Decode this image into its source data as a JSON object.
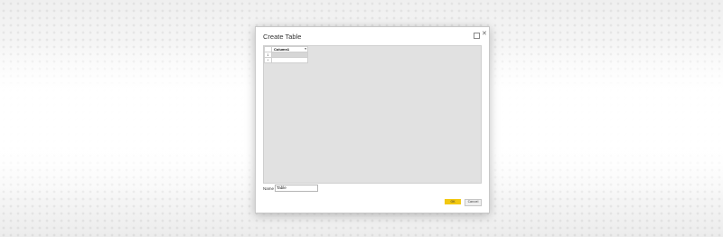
{
  "dialog": {
    "title": "Create Table",
    "restore_icon": "restore-icon",
    "close_glyph": "✕"
  },
  "table": {
    "column_header": "Column1",
    "dropdown_glyph": "▾",
    "rows": [
      {
        "marker": "1",
        "value": ""
      },
      {
        "marker": "*",
        "value": ""
      }
    ]
  },
  "name_field": {
    "label": "Name",
    "value": "Table"
  },
  "buttons": {
    "ok": "OK",
    "cancel": "Cancel"
  },
  "colors": {
    "accent": "#f2c811",
    "canvas": "#e1e1e1"
  }
}
